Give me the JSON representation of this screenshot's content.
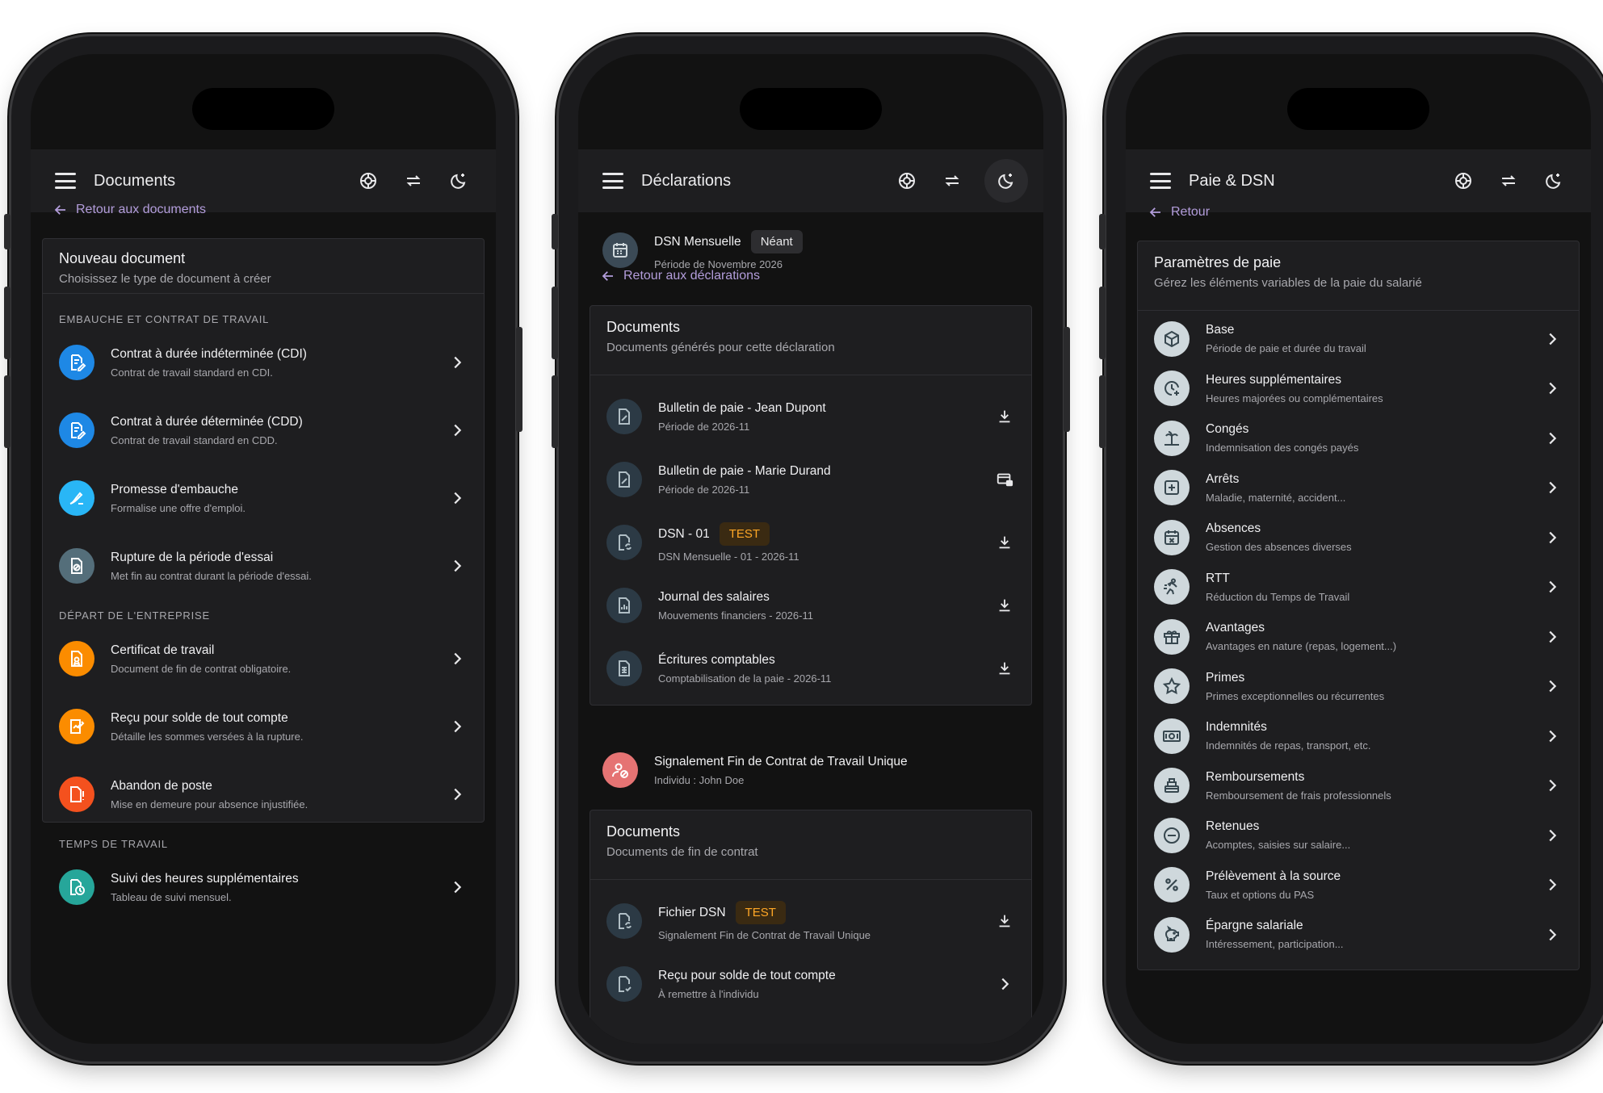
{
  "colors": {
    "accent": "#b39ddb",
    "blue": "#1e88e5",
    "sky": "#29b6f6",
    "orange": "#fb8c00",
    "deep_orange": "#f4511e",
    "teal": "#26a69a",
    "red": "#e57373",
    "slate": "#546e7a",
    "test_badge": "#ffa726"
  },
  "phone1": {
    "title": "Documents",
    "back": "Retour aux documents",
    "card": {
      "title": "Nouveau document",
      "subtitle": "Choisissez le type de document à créer"
    },
    "sections": [
      {
        "label": "EMBAUCHE ET CONTRAT DE TRAVAIL",
        "items": [
          {
            "title": "Contrat à durée indéterminée (CDI)",
            "subtitle": "Contrat de travail standard en CDI.",
            "icon": "document-edit-icon"
          },
          {
            "title": "Contrat à durée déterminée (CDD)",
            "subtitle": "Contrat de travail standard en CDD.",
            "icon": "document-edit-icon"
          },
          {
            "title": "Promesse d'embauche",
            "subtitle": "Formalise une offre d'emploi.",
            "icon": "signature-icon"
          },
          {
            "title": "Rupture de la période d'essai",
            "subtitle": "Met fin au contrat durant la période d'essai.",
            "icon": "document-cancel-icon"
          }
        ]
      },
      {
        "label": "DÉPART DE L'ENTREPRISE",
        "items": [
          {
            "title": "Certificat de travail",
            "subtitle": "Document de fin de contrat obligatoire.",
            "icon": "certificate-icon"
          },
          {
            "title": "Reçu pour solde de tout compte",
            "subtitle": "Détaille les sommes versées à la rupture.",
            "icon": "receipt-icon"
          },
          {
            "title": "Abandon de poste",
            "subtitle": "Mise en demeure pour absence injustifiée.",
            "icon": "document-alert-icon"
          }
        ]
      },
      {
        "label": "TEMPS DE TRAVAIL",
        "items": [
          {
            "title": "Suivi des heures supplémentaires",
            "subtitle": "Tableau de suivi mensuel.",
            "icon": "clock-document-icon"
          }
        ]
      }
    ]
  },
  "phone2": {
    "title": "Déclarations",
    "header": {
      "title": "DSN Mensuelle",
      "badge": "Néant",
      "subtitle": "Période de Novembre 2026"
    },
    "back": "Retour aux déclarations",
    "card1": {
      "title": "Documents",
      "subtitle": "Documents générés pour cette déclaration",
      "items": [
        {
          "title": "Bulletin de paie - Jean Dupont",
          "subtitle": "Période de 2026-11",
          "badge": "",
          "trail": "download-icon"
        },
        {
          "title": "Bulletin de paie - Marie Durand",
          "subtitle": "Période de 2026-11",
          "badge": "",
          "trail": "payment-card-icon"
        },
        {
          "title": "DSN - 01",
          "subtitle": "DSN Mensuelle - 01 - 2026-11",
          "badge": "TEST",
          "trail": "download-icon"
        },
        {
          "title": "Journal des salaires",
          "subtitle": "Mouvements financiers - 2026-11",
          "badge": "",
          "trail": "download-icon"
        },
        {
          "title": "Écritures comptables",
          "subtitle": "Comptabilisation de la paie - 2026-11",
          "badge": "",
          "trail": "download-icon"
        }
      ]
    },
    "signal": {
      "title": "Signalement Fin de Contrat de Travail Unique",
      "subtitle": "Individu : John Doe"
    },
    "card2": {
      "title": "Documents",
      "subtitle": "Documents de fin de contrat",
      "items": [
        {
          "title": "Fichier DSN",
          "subtitle": "Signalement Fin de Contrat de Travail Unique",
          "badge": "TEST",
          "trail": "download-icon"
        },
        {
          "title": "Reçu pour solde de tout compte",
          "subtitle": "À remettre à l'individu",
          "badge": "",
          "trail": "chevron-right-icon"
        }
      ]
    }
  },
  "phone3": {
    "title": "Paie & DSN",
    "back": "Retour",
    "card": {
      "title": "Paramètres de paie",
      "subtitle": "Gérez les éléments variables de la paie du salarié",
      "items": [
        {
          "title": "Base",
          "subtitle": "Période de paie et durée du travail",
          "icon": "cube-icon"
        },
        {
          "title": "Heures supplémentaires",
          "subtitle": "Heures majorées ou complémentaires",
          "icon": "clock-plus-icon"
        },
        {
          "title": "Congés",
          "subtitle": "Indemnisation des congés payés",
          "icon": "beach-icon"
        },
        {
          "title": "Arrêts",
          "subtitle": "Maladie, maternité, accident...",
          "icon": "medical-cross-icon"
        },
        {
          "title": "Absences",
          "subtitle": "Gestion des absences diverses",
          "icon": "calendar-remove-icon"
        },
        {
          "title": "RTT",
          "subtitle": "Réduction du Temps de Travail",
          "icon": "running-person-icon"
        },
        {
          "title": "Avantages",
          "subtitle": "Avantages en nature (repas, logement...)",
          "icon": "gift-icon"
        },
        {
          "title": "Primes",
          "subtitle": "Primes exceptionnelles ou récurrentes",
          "icon": "star-icon"
        },
        {
          "title": "Indemnités",
          "subtitle": "Indemnités de repas, transport, etc.",
          "icon": "cash-icon"
        },
        {
          "title": "Remboursements",
          "subtitle": "Remboursement de frais professionnels",
          "icon": "cash-register-icon"
        },
        {
          "title": "Retenues",
          "subtitle": "Acomptes, saisies sur salaire...",
          "icon": "minus-circle-icon"
        },
        {
          "title": "Prélèvement à la source",
          "subtitle": "Taux et options du PAS",
          "icon": "percent-icon"
        },
        {
          "title": "Épargne salariale",
          "subtitle": "Intéressement, participation...",
          "icon": "piggy-bank-icon"
        }
      ]
    }
  }
}
